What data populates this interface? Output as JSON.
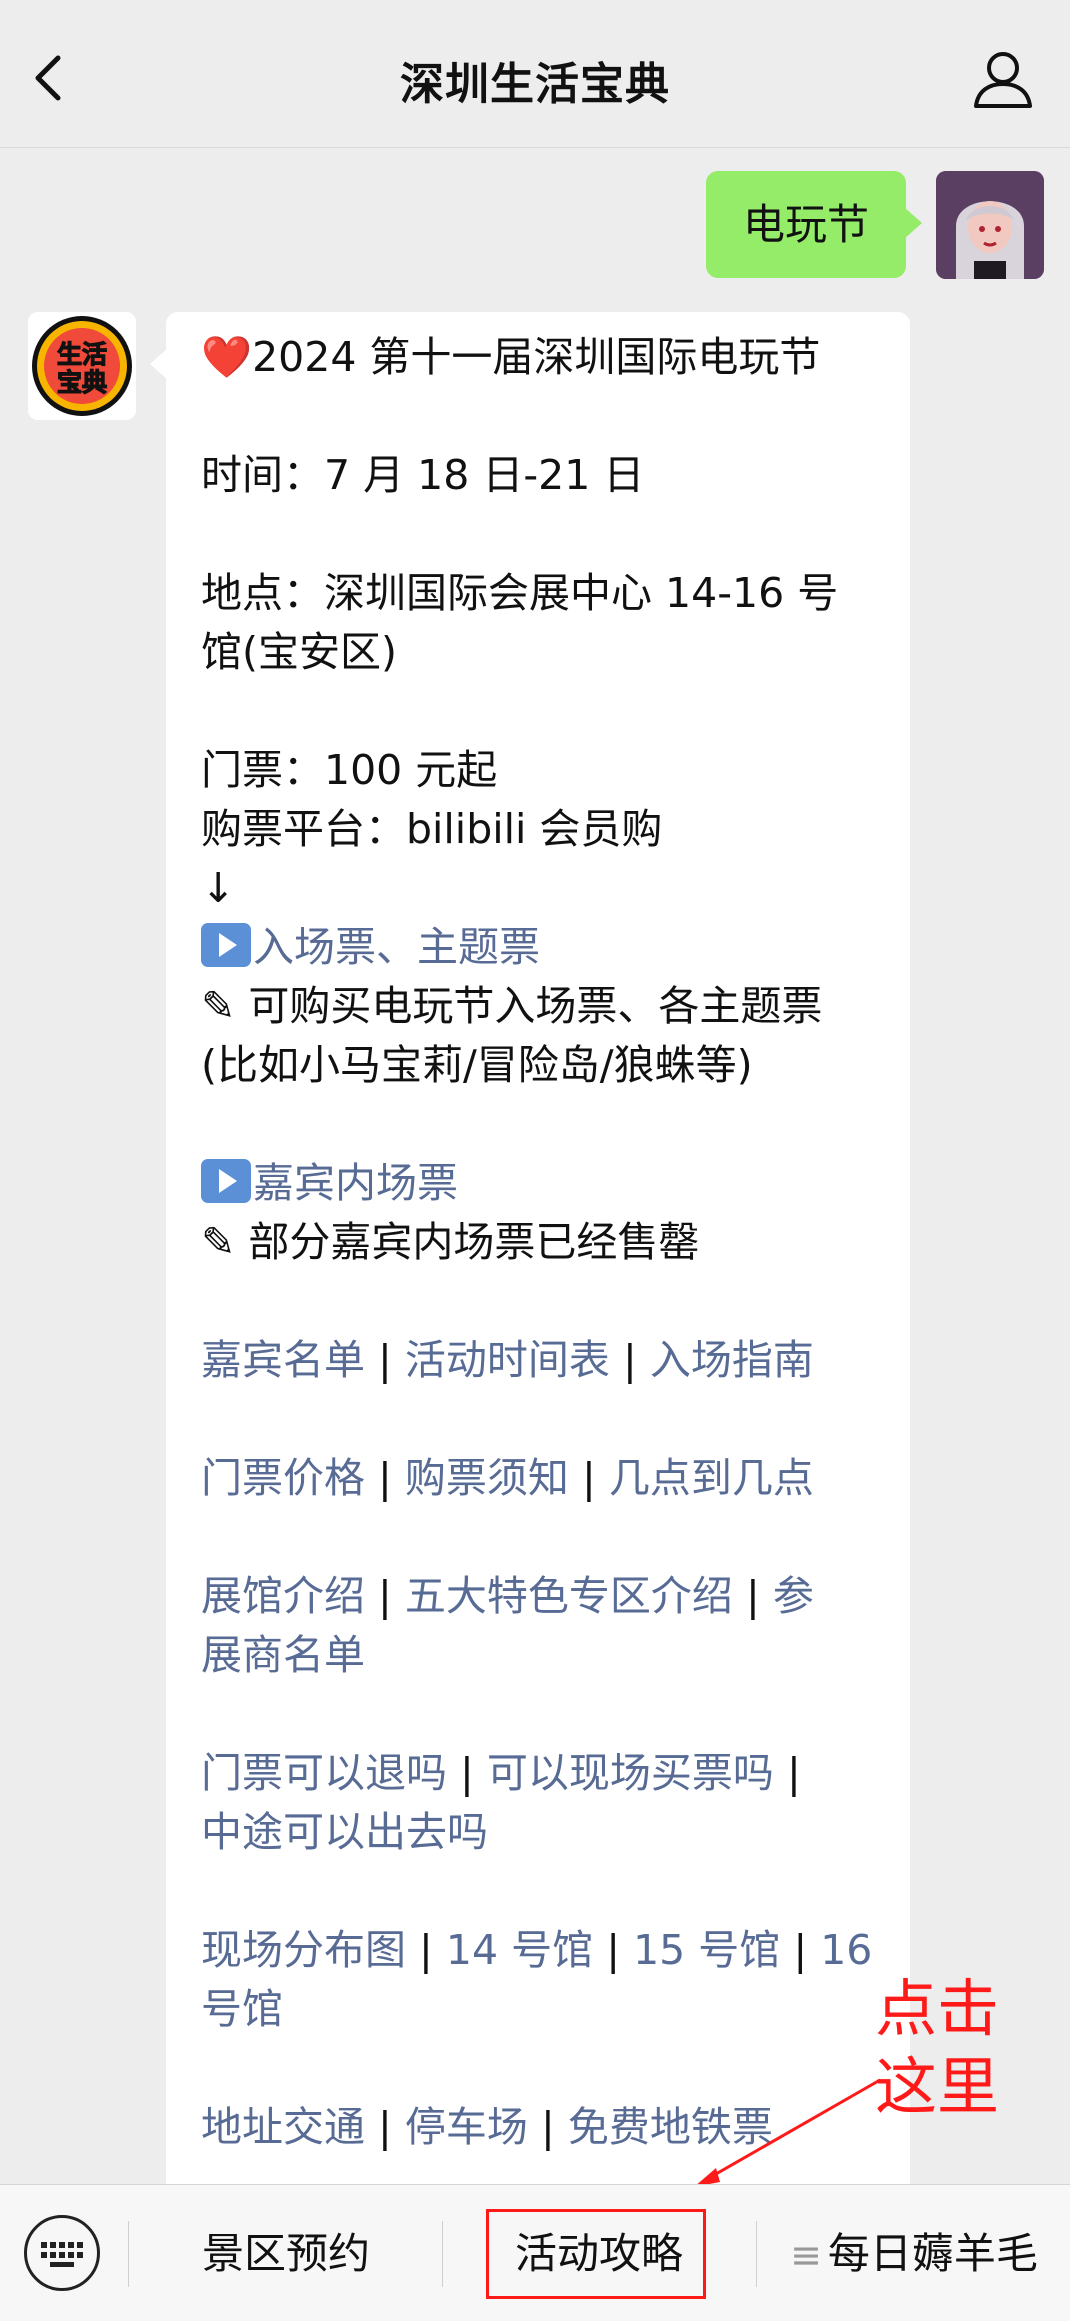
{
  "header": {
    "title": "深圳生活宝典"
  },
  "chat": {
    "user_message": "电玩节",
    "bot_lines": {
      "title_heart": "❤️",
      "title": "2024 第十一届深圳国际电玩节",
      "time": "时间：7 月 18 日-21 日",
      "place_1": "地点：深圳国际会展中心 14-16 号",
      "place_2": "馆(宝安区)",
      "ticket": "门票：100 元起",
      "platform": "购票平台：bilibili 会员购",
      "arrow_down": "↓",
      "link_entry": "入场票、主题票",
      "entry_note_1": "✎ 可购买电玩节入场票、各主题票",
      "entry_note_2": "(比如小马宝莉/冒险岛/狼蛛等)",
      "link_guest": "嘉宾内场票",
      "guest_note": "✎ 部分嘉宾内场票已经售罄"
    },
    "links": {
      "guest_list": "嘉宾名单",
      "schedule": "活动时间表",
      "entry_guide": "入场指南",
      "ticket_price": "门票价格",
      "purchase_notice": "购票须知",
      "hours": "几点到几点",
      "venue_intro": "展馆介绍",
      "zones_intro": "五大特色专区介绍",
      "exhibitors_1": "参",
      "exhibitors_2": "展商名单",
      "refund": "门票可以退吗",
      "buy_onsite": "可以现场买票吗",
      "reentry": "中途可以出去吗",
      "site_map": "现场分布图",
      "hall_14": "14 号馆",
      "hall_15": "15 号馆",
      "hall_16_a": "16",
      "hall_16_b": "号馆",
      "transport": "地址交通",
      "parking": "停车场",
      "free_metro": "免费地铁票"
    },
    "separator": "|"
  },
  "annotation": {
    "line1": "点击",
    "line2": "这里"
  },
  "bottom_menu": {
    "item1": "景区预约",
    "item2": "活动攻略",
    "item3_icon": "≡",
    "item3": "每日薅羊毛"
  },
  "colors": {
    "link": "#576b95",
    "user_bubble": "#95ec69",
    "annotation": "#ff1a1a"
  }
}
